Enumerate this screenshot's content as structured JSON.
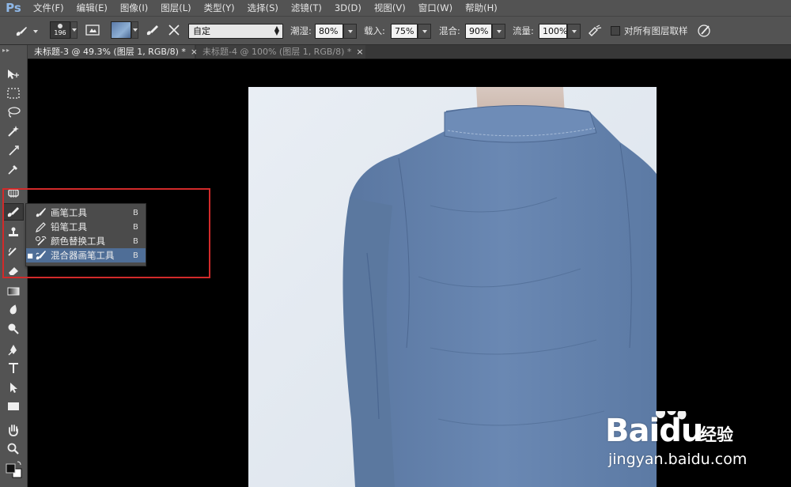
{
  "app": {
    "logo": "Ps"
  },
  "menu": [
    "文件(F)",
    "编辑(E)",
    "图像(I)",
    "图层(L)",
    "类型(Y)",
    "选择(S)",
    "滤镜(T)",
    "3D(D)",
    "视图(V)",
    "窗口(W)",
    "帮助(H)"
  ],
  "options": {
    "brush_size": "196",
    "preset": "自定",
    "wet_label": "潮湿:",
    "wet_value": "80%",
    "load_label": "载入:",
    "load_value": "75%",
    "mix_label": "混合:",
    "mix_value": "90%",
    "flow_label": "流量:",
    "flow_value": "100%",
    "sample_all_label": "对所有图层取样"
  },
  "tabs": [
    {
      "label": "未标题-3 @ 49.3% (图层 1, RGB/8) *",
      "close": "×",
      "active": true
    },
    {
      "label": "未标题-4 @ 100% (图层 1, RGB/8) *",
      "close": "×",
      "active": false
    }
  ],
  "flyout": {
    "items": [
      {
        "label": "画笔工具",
        "shortcut": "B",
        "selected": false
      },
      {
        "label": "铅笔工具",
        "shortcut": "B",
        "selected": false
      },
      {
        "label": "颜色替换工具",
        "shortcut": "B",
        "selected": false
      },
      {
        "label": "混合器画笔工具",
        "shortcut": "B",
        "selected": true
      }
    ]
  },
  "watermark": {
    "brand": "Bai",
    "brand_tail": "du",
    "sub": "经验",
    "url": "jingyan.baidu.com"
  },
  "colors": {
    "highlight": "#d22a2a",
    "menu_bg": "#535353",
    "selected_item": "#4f6e97",
    "shirt": "#6583ad"
  }
}
